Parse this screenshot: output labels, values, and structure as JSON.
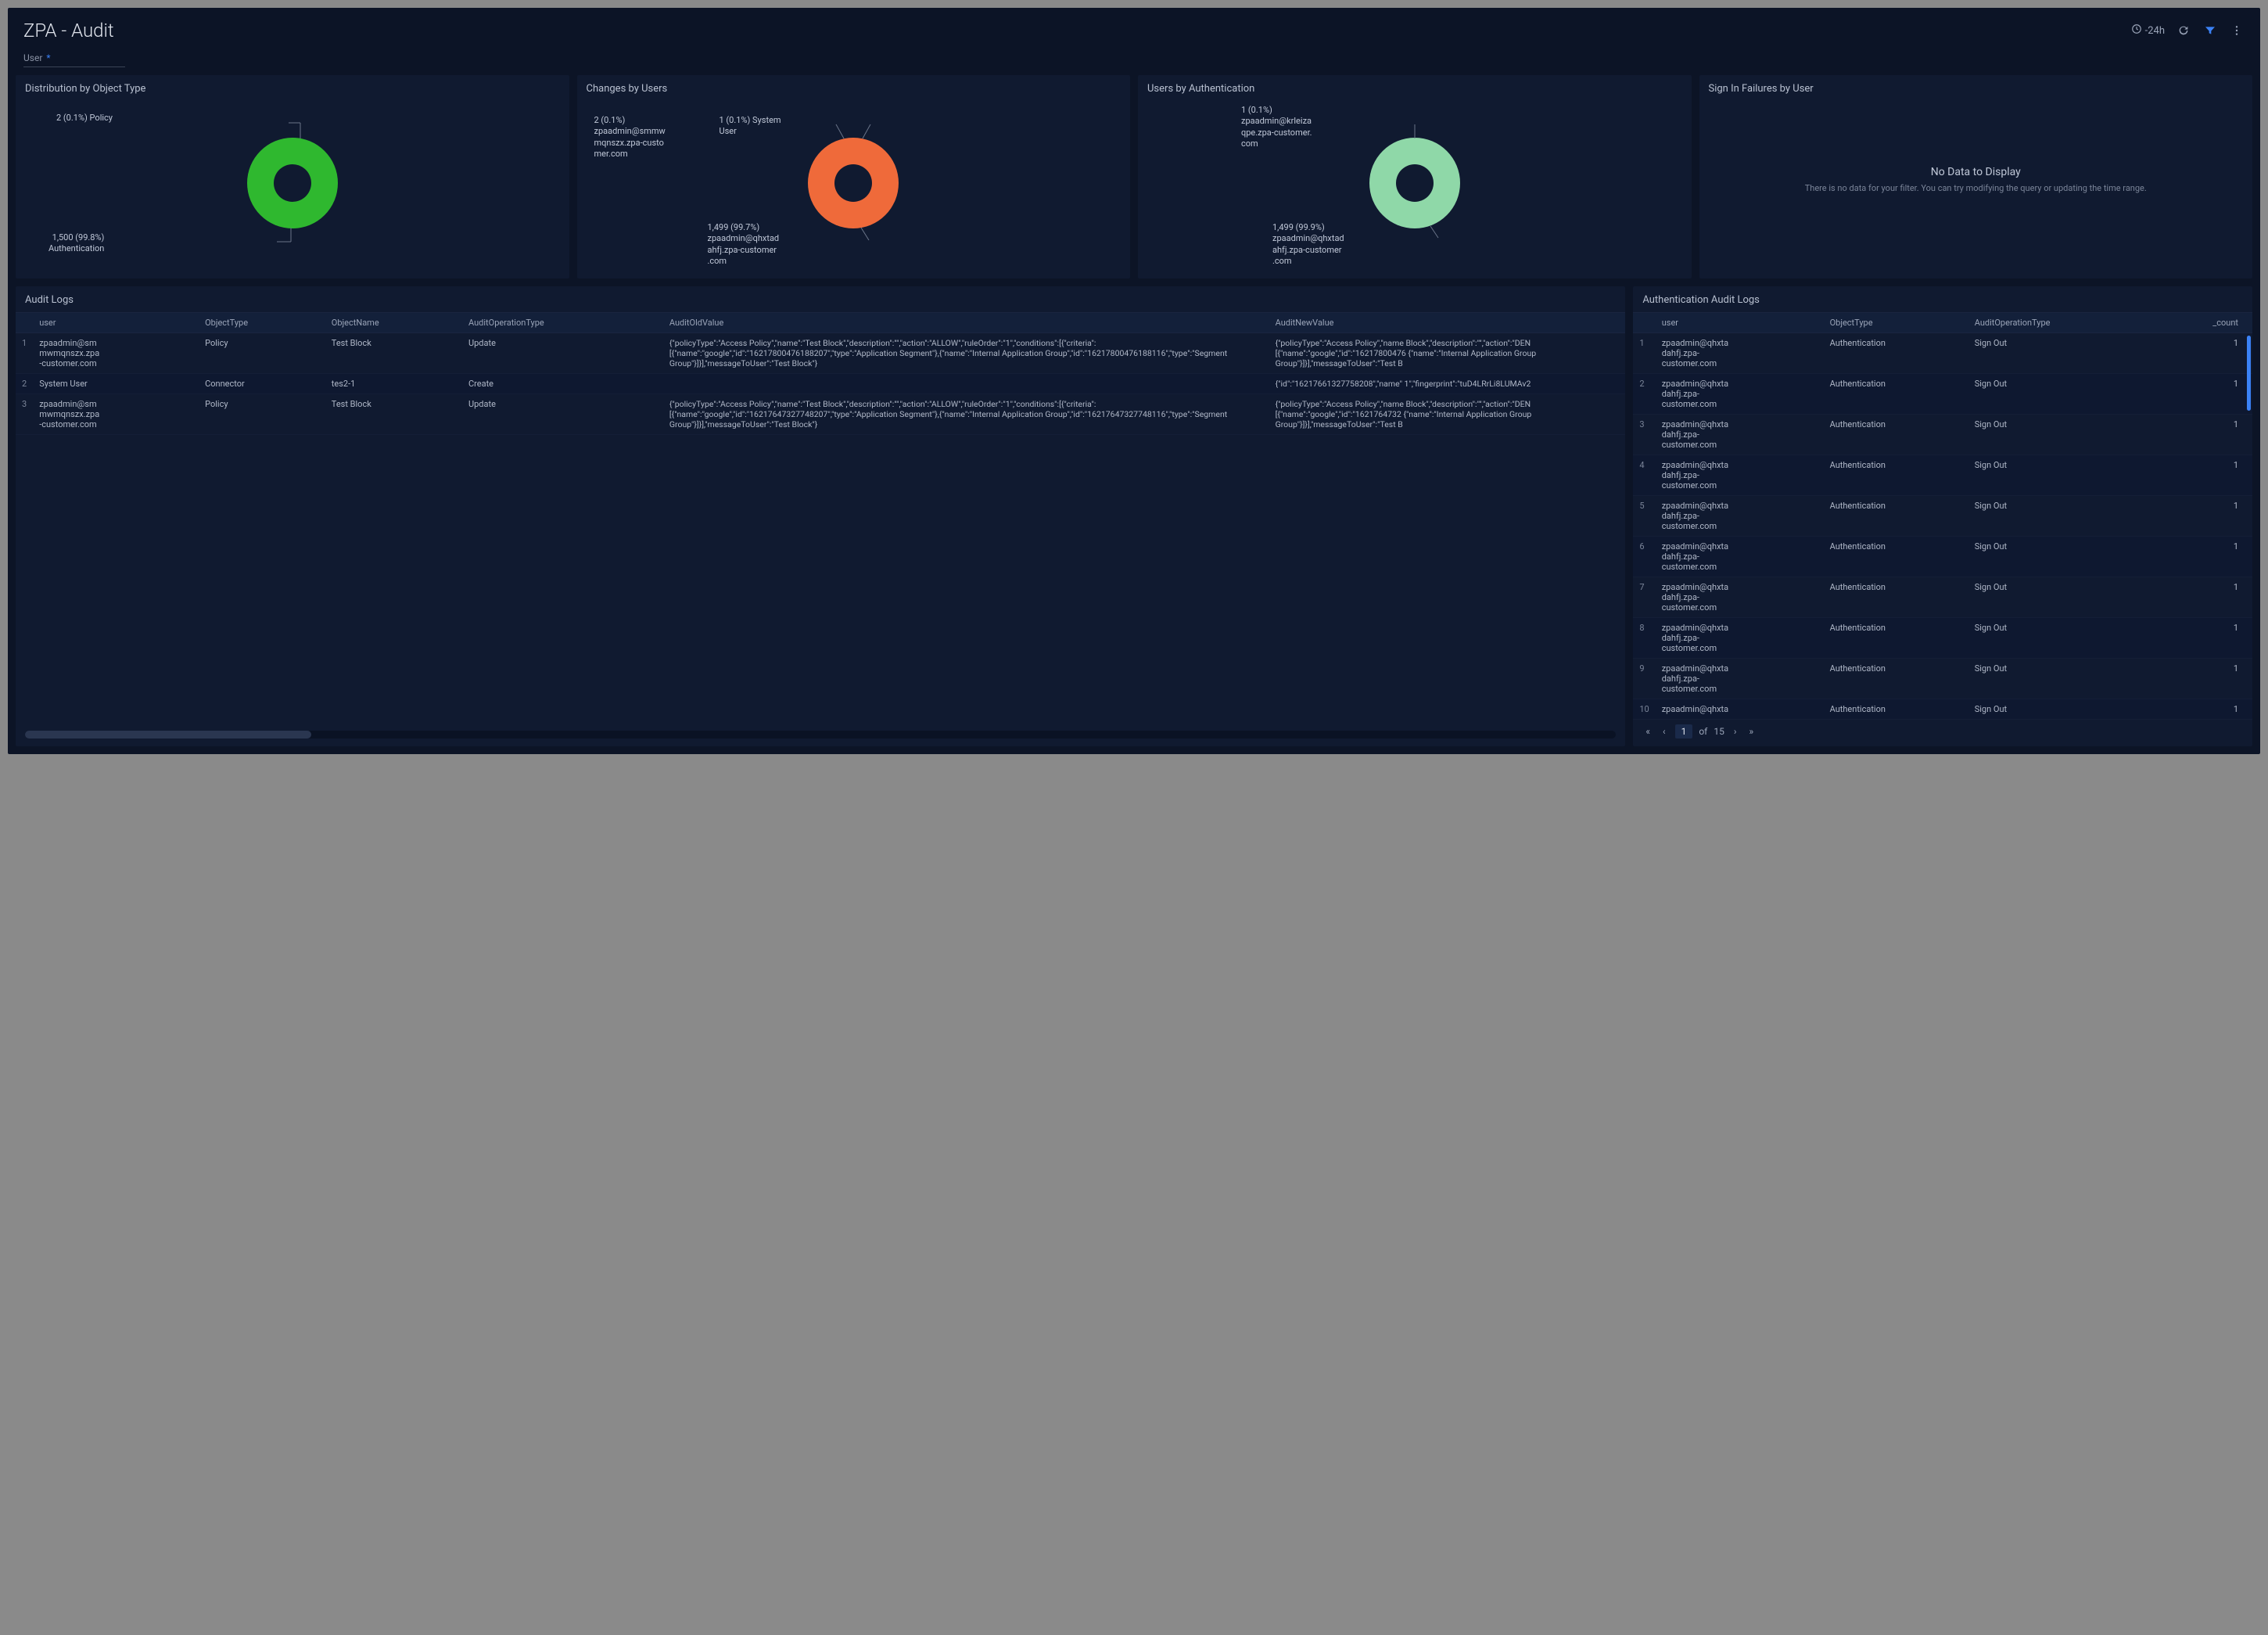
{
  "header": {
    "title": "ZPA - Audit",
    "time_range": "-24h"
  },
  "filter": {
    "user_label": "User",
    "user_required": "*"
  },
  "panels": {
    "dist": {
      "title": "Distribution by Object Type",
      "top_label": "2 (0.1%) Policy",
      "bottom_label": "1,500 (99.8%)\nAuthentication"
    },
    "changes": {
      "title": "Changes by Users",
      "top_left_label": "2 (0.1%)\nzpaadmin@smmw\nmqnszx.zpa-custo\nmer.com",
      "top_right_label": "1 (0.1%) System\nUser",
      "bottom_label": "1,499 (99.7%)\nzpaadmin@qhxtad\nahfj.zpa-customer\n.com"
    },
    "auth": {
      "title": "Users by Authentication",
      "top_label": "1 (0.1%)\nzpaadmin@krleiza\nqpe.zpa-customer.\ncom",
      "bottom_label": "1,499 (99.9%)\nzpaadmin@qhxtad\nahfj.zpa-customer\n.com"
    },
    "signin_fail": {
      "title": "Sign In Failures by User",
      "no_data_title": "No Data to Display",
      "no_data_sub": "There is no data for your filter. You can try modifying the query or updating the time range."
    }
  },
  "chart_data": [
    {
      "type": "pie",
      "title": "Distribution by Object Type",
      "series": [
        {
          "name": "Authentication",
          "value": 1500,
          "pct": 99.8,
          "color": "#2fb82f"
        },
        {
          "name": "Policy",
          "value": 2,
          "pct": 0.1,
          "color": "#1a7a1a"
        }
      ]
    },
    {
      "type": "pie",
      "title": "Changes by Users",
      "series": [
        {
          "name": "zpaadmin@qhxtadahfj.zpa-customer.com",
          "value": 1499,
          "pct": 99.7,
          "color": "#ef6a3a"
        },
        {
          "name": "zpaadmin@smmwmqnszx.zpa-customer.com",
          "value": 2,
          "pct": 0.1,
          "color": "#c44a1a"
        },
        {
          "name": "System User",
          "value": 1,
          "pct": 0.1,
          "color": "#a03a10"
        }
      ]
    },
    {
      "type": "pie",
      "title": "Users by Authentication",
      "series": [
        {
          "name": "zpaadmin@qhxtadahfj.zpa-customer.com",
          "value": 1499,
          "pct": 99.9,
          "color": "#8fd8a8"
        },
        {
          "name": "zpaadmin@krleizaqpe.zpa-customer.com",
          "value": 1,
          "pct": 0.1,
          "color": "#5aa878"
        }
      ]
    },
    {
      "type": "table",
      "title": "Sign In Failures by User",
      "series": []
    }
  ],
  "audit_logs": {
    "title": "Audit Logs",
    "columns": [
      "user",
      "ObjectType",
      "ObjectName",
      "AuditOperationType",
      "AuditOldValue",
      "AuditNewValue"
    ],
    "rows": [
      {
        "idx": "1",
        "user": "zpaadmin@sm\nmwmqnszx.zpa\n-customer.com",
        "ObjectType": "Policy",
        "ObjectName": "Test Block",
        "AuditOperationType": "Update",
        "AuditOldValue": "{\"policyType\":\"Access Policy\",\"name\":\"Test Block\",\"description\":\"\",\"action\":\"ALLOW\",\"ruleOrder\":\"1\",\"conditions\":[{\"criteria\":[{\"name\":\"google\",\"id\":\"16217800476188207\",\"type\":\"Application Segment\"},{\"name\":\"Internal Application Group\",\"id\":\"16217800476188116\",\"type\":\"Segment Group\"}]}],\"messageToUser\":\"Test Block\"}",
        "AuditNewValue": "{\"policyType\":\"Access Policy\",\"name Block\",\"description\":\"\",\"action\":\"DEN [{\"name\":\"google\",\"id\":\"16217800476 {\"name\":\"Internal Application Group Group\"}]}],\"messageToUser\":\"Test B"
      },
      {
        "idx": "2",
        "user": "System User",
        "ObjectType": "Connector",
        "ObjectName": "tes2-1",
        "AuditOperationType": "Create",
        "AuditOldValue": "",
        "AuditNewValue": "{\"id\":\"16217661327758208\",\"name\" 1\",\"fingerprint\":\"tuD4LRrLi8LUMAv2"
      },
      {
        "idx": "3",
        "user": "zpaadmin@sm\nmwmqnszx.zpa\n-customer.com",
        "ObjectType": "Policy",
        "ObjectName": "Test Block",
        "AuditOperationType": "Update",
        "AuditOldValue": "{\"policyType\":\"Access Policy\",\"name\":\"Test Block\",\"description\":\"\",\"action\":\"ALLOW\",\"ruleOrder\":\"1\",\"conditions\":[{\"criteria\":[{\"name\":\"google\",\"id\":\"16217647327748207\",\"type\":\"Application Segment\"},{\"name\":\"Internal Application Group\",\"id\":\"16217647327748116\",\"type\":\"Segment Group\"}]}],\"messageToUser\":\"Test Block\"}",
        "AuditNewValue": "{\"policyType\":\"Access Policy\",\"name Block\",\"description\":\"\",\"action\":\"DEN [{\"name\":\"google\",\"id\":\"1621764732 {\"name\":\"Internal Application Group Group\"}]}],\"messageToUser\":\"Test B"
      }
    ]
  },
  "auth_logs": {
    "title": "Authentication Audit Logs",
    "columns": [
      "user",
      "ObjectType",
      "AuditOperationType",
      "_count"
    ],
    "rows": [
      {
        "idx": "1",
        "user": "zpaadmin@qhxta\ndahfj.zpa-\ncustomer.com",
        "ObjectType": "Authentication",
        "AuditOperationType": "Sign Out",
        "_count": "1"
      },
      {
        "idx": "2",
        "user": "zpaadmin@qhxta\ndahfj.zpa-\ncustomer.com",
        "ObjectType": "Authentication",
        "AuditOperationType": "Sign Out",
        "_count": "1"
      },
      {
        "idx": "3",
        "user": "zpaadmin@qhxta\ndahfj.zpa-\ncustomer.com",
        "ObjectType": "Authentication",
        "AuditOperationType": "Sign Out",
        "_count": "1"
      },
      {
        "idx": "4",
        "user": "zpaadmin@qhxta\ndahfj.zpa-\ncustomer.com",
        "ObjectType": "Authentication",
        "AuditOperationType": "Sign Out",
        "_count": "1"
      },
      {
        "idx": "5",
        "user": "zpaadmin@qhxta\ndahfj.zpa-\ncustomer.com",
        "ObjectType": "Authentication",
        "AuditOperationType": "Sign Out",
        "_count": "1"
      },
      {
        "idx": "6",
        "user": "zpaadmin@qhxta\ndahfj.zpa-\ncustomer.com",
        "ObjectType": "Authentication",
        "AuditOperationType": "Sign Out",
        "_count": "1"
      },
      {
        "idx": "7",
        "user": "zpaadmin@qhxta\ndahfj.zpa-\ncustomer.com",
        "ObjectType": "Authentication",
        "AuditOperationType": "Sign Out",
        "_count": "1"
      },
      {
        "idx": "8",
        "user": "zpaadmin@qhxta\ndahfj.zpa-\ncustomer.com",
        "ObjectType": "Authentication",
        "AuditOperationType": "Sign Out",
        "_count": "1"
      },
      {
        "idx": "9",
        "user": "zpaadmin@qhxta\ndahfj.zpa-\ncustomer.com",
        "ObjectType": "Authentication",
        "AuditOperationType": "Sign Out",
        "_count": "1"
      },
      {
        "idx": "10",
        "user": "zpaadmin@qhxta",
        "ObjectType": "Authentication",
        "AuditOperationType": "Sign Out",
        "_count": "1"
      }
    ],
    "pager": {
      "current": "1",
      "of": "of",
      "total": "15"
    }
  }
}
